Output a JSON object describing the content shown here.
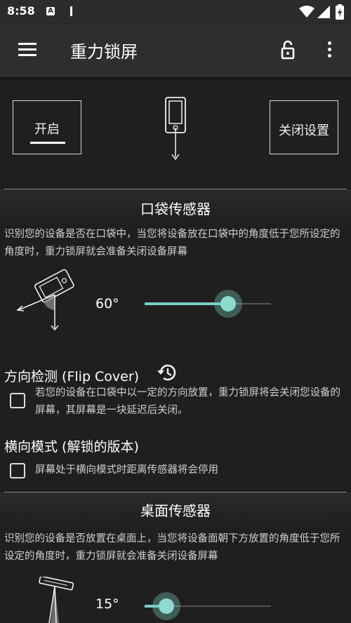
{
  "status_bar": {
    "time": "8:58",
    "app_icon_letter": "A",
    "icons": [
      "wifi-icon",
      "signal-icon",
      "battery-icon"
    ]
  },
  "app_bar": {
    "title": "重力锁屏",
    "icons": [
      "menu-icon",
      "lock-open-icon",
      "more-vert-icon"
    ]
  },
  "header_controls": {
    "open_label": "开启",
    "close_settings_label": "关闭设置"
  },
  "pocket_sensor": {
    "title": "口袋传感器",
    "description": "识别您的设备是否在口袋中，当您将设备放在口袋中的角度低于您所设定的角度时，重力锁屏就会准备关闭设备屏幕",
    "angle_label": "60°",
    "slider_fraction": 0.66
  },
  "flip_cover": {
    "title": "方向检测 (Flip Cover)",
    "checkbox_text": "若您的设备在口袋中以一定的方向放置，重力锁屏将会关闭您设备的屏幕，其屏幕是一块延迟后关闭。",
    "checked": false
  },
  "landscape_mode": {
    "title": "横向模式 (解锁的版本)",
    "checkbox_text": "屏幕处于横向模式时距离传感器将会停用",
    "checked": false
  },
  "table_sensor": {
    "title": "桌面传感器",
    "description": "识别您的设备是否放置在桌面上，当您将设备面朝下方放置的角度低于您所设定的角度时，重力锁屏就会准备关闭设备屏幕",
    "angle_label": "15°",
    "slider_fraction": 0.17
  },
  "colors": {
    "accent": "#7ad0c4",
    "background": "#1f1f1f",
    "app_bar": "#2e2e2e"
  }
}
